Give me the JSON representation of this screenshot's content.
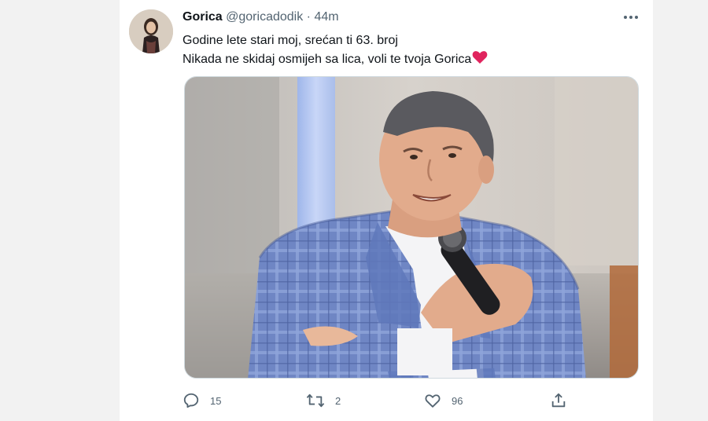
{
  "tweet": {
    "author_name": "Gorica",
    "author_handle": "@goricadodik",
    "separator": "·",
    "time": "44m",
    "text_line1": "Godine lete stari moj, srećan ti 63. broj",
    "text_line2": "Nikada ne skidaj osmijeh sa lica, voli te tvoja Gorica",
    "emoji": "red-heart-emoji"
  },
  "actions": {
    "reply_count": "15",
    "retweet_count": "2",
    "like_count": "96"
  },
  "icons": {
    "more": "more-dots-icon",
    "reply": "reply-bubble-icon",
    "retweet": "retweet-icon",
    "like": "heart-outline-icon",
    "share": "share-upload-icon"
  },
  "colors": {
    "text": "#0f1419",
    "muted": "#536471",
    "heart": "#e0245e",
    "background": "#ffffff"
  }
}
